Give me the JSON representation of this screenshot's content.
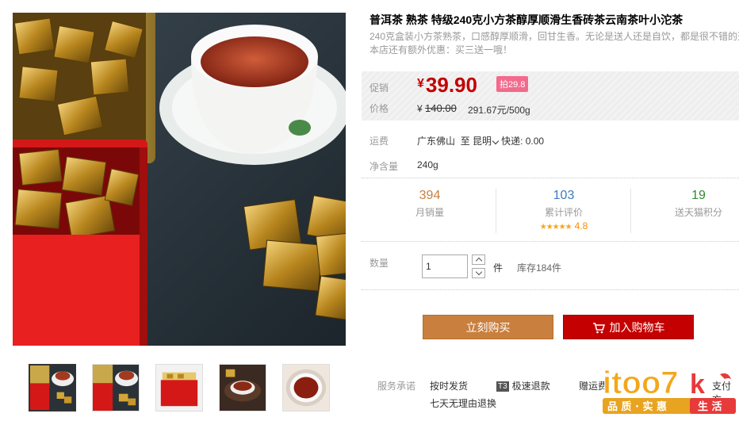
{
  "product": {
    "title": "普洱茶 熟茶 特级240克小方茶醇厚顺滑生香砖茶云南茶叶小沱茶",
    "subtitle_line1": "240克盒装小方茶熟茶，口感醇厚顺滑，回甘生香。无论是送人还是自饮，都是很不错的选择",
    "subtitle_line2": "本店还有额外优惠：买三送一哦！"
  },
  "price": {
    "promo_label": "促销",
    "currency": "¥",
    "promo_value": "39.90",
    "discount_tag": "拍29.8",
    "price_label": "价格",
    "original_value": "140.00",
    "unit_price": "291.67元/500g"
  },
  "shipping": {
    "label": "运费",
    "from": "广东佛山",
    "to_word": "至",
    "to": "昆明",
    "express": "快递: 0.00"
  },
  "net_content": {
    "label": "净含量",
    "value": "240g"
  },
  "stats": {
    "monthly_sales": {
      "value": "394",
      "label": "月销量",
      "color": "#c97f3e"
    },
    "reviews": {
      "value": "103",
      "label": "累计评价",
      "color": "#3d7bbf",
      "rating": "4.8",
      "stars": 5
    },
    "points": {
      "value": "19",
      "label": "送天猫积分",
      "color": "#2e8b2e"
    }
  },
  "quantity": {
    "label": "数量",
    "value": "1",
    "unit": "件",
    "stock": "库存184件"
  },
  "buttons": {
    "buy_now": "立刻购买",
    "add_to_cart": "加入购物车"
  },
  "services": {
    "label": "服务承诺",
    "items": [
      "按时发货",
      "极速退款",
      "赠运费",
      "支付方",
      "七天无理由退换"
    ],
    "t3_badge": "T3"
  },
  "watermark": {
    "brand": "itoo7",
    "tagline": "品质·实惠 生活"
  },
  "thumbnails": [
    {
      "name": "tins-and-cup"
    },
    {
      "name": "tins-and-cup-2"
    },
    {
      "name": "red-tin"
    },
    {
      "name": "cup-close"
    },
    {
      "name": "tea-bowl"
    }
  ]
}
